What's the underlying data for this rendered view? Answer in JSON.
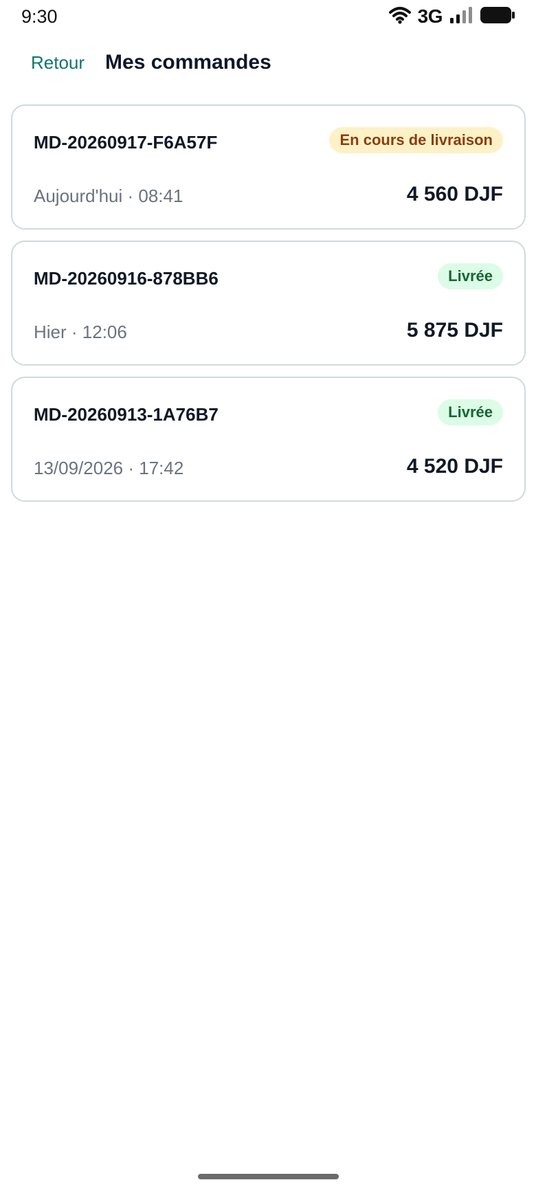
{
  "status_bar": {
    "time": "9:30",
    "network": "3G",
    "icons": [
      "wifi-icon",
      "signal-icon",
      "battery-icon"
    ]
  },
  "header": {
    "back_label": "Retour",
    "title": "Mes commandes"
  },
  "colors": {
    "accent": "#0f766e",
    "badge_in_progress_bg": "#fdf1c7",
    "badge_in_progress_text": "#8a3d0f",
    "badge_delivered_bg": "#dcfce7",
    "badge_delivered_text": "#166534"
  },
  "orders": [
    {
      "id": "MD-20260917-F6A57F",
      "status": "En cours de livraison",
      "date": "Aujourd'hui · 08:41",
      "total": "4 560 DJF"
    },
    {
      "id": "MD-20260916-878BB6",
      "status": "Livrée",
      "date": "Hier · 12:06",
      "total": "5 875 DJF"
    },
    {
      "id": "MD-20260913-1A76B7",
      "status": "Livrée",
      "date": "13/09/2026 · 17:42",
      "total": "4 520 DJF"
    }
  ]
}
